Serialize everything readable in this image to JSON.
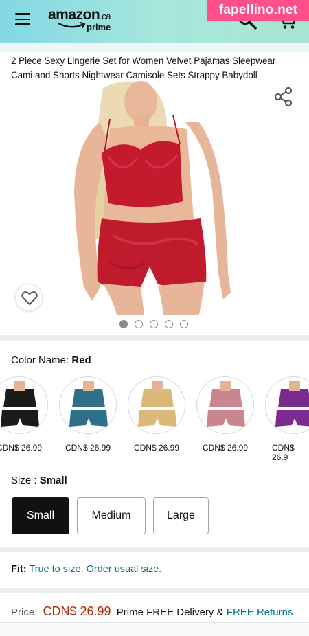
{
  "header": {
    "logo_text": "amazon",
    "logo_suffix": ".ca",
    "logo_prime": "prime",
    "menu_icon": "hamburger-menu-icon",
    "search_icon": "search-icon",
    "cart_icon": "cart-icon",
    "background_colors": [
      "#82d8e3",
      "#a9e5d2"
    ]
  },
  "watermark": "fapellino.net",
  "product": {
    "title": "2 Piece Sexy Lingerie Set for Women Velvet Pajamas Sleepwear Cami and Shorts Nightwear Camisole Sets Strappy Babydoll",
    "share_icon": "share-icon",
    "wishlist_icon": "heart-icon",
    "image_count": 5,
    "active_image": 1
  },
  "color": {
    "label": "Color Name: ",
    "selected": "Red",
    "swatches": [
      {
        "color": "#1b1b1b",
        "price": "CDN$ 26.99"
      },
      {
        "color": "#2f6f8a",
        "price": "CDN$ 26.99"
      },
      {
        "color": "#d9b878",
        "price": "CDN$ 26.99"
      },
      {
        "color": "#c9868f",
        "price": "CDN$ 26.99"
      },
      {
        "color": "#7b2a8e",
        "price": "CDN$ 26.9"
      }
    ]
  },
  "size": {
    "label": "Size : ",
    "selected": "Small",
    "options": [
      "Small",
      "Medium",
      "Large"
    ]
  },
  "fit": {
    "label": "Fit:",
    "text": "True to size. Order usual size."
  },
  "price": {
    "label": "Price:",
    "value": "CDN$ 26.99",
    "delivery": "Prime FREE Delivery &",
    "returns": "FREE Returns"
  },
  "colors": {
    "price_red": "#b12704",
    "link_teal": "#007185",
    "product_red": "#c41a2e"
  }
}
